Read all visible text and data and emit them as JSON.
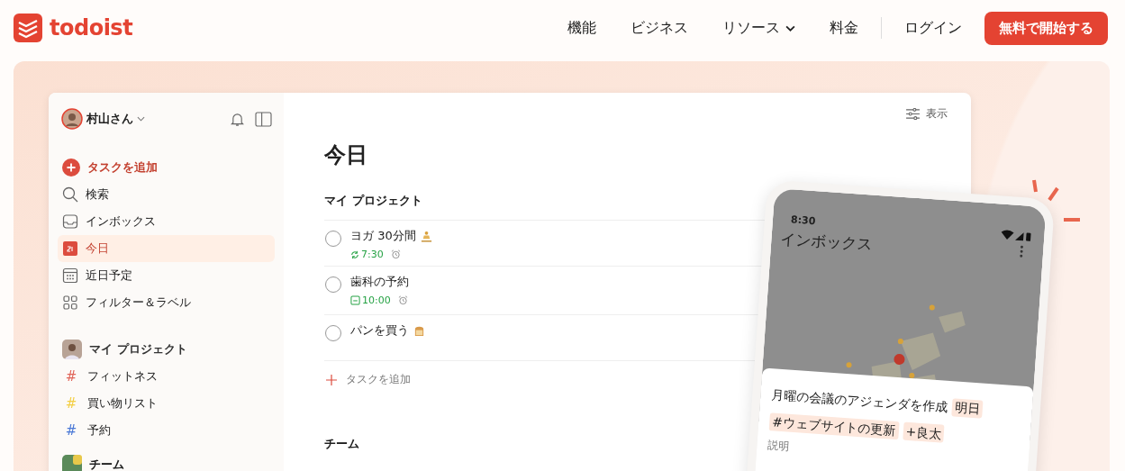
{
  "header": {
    "logo": "todoist",
    "nav": [
      {
        "label": "機能",
        "dropdown": false
      },
      {
        "label": "ビジネス",
        "dropdown": false
      },
      {
        "label": "リソース",
        "dropdown": true
      },
      {
        "label": "料金",
        "dropdown": false
      }
    ],
    "login": "ログイン",
    "cta": "無料で開始する"
  },
  "sidebar": {
    "user": "村山さん",
    "items": [
      {
        "label": "タスクを追加",
        "kind": "add",
        "selected": false
      },
      {
        "label": "検索",
        "kind": "search",
        "selected": false
      },
      {
        "label": "インボックス",
        "kind": "inbox",
        "selected": false
      },
      {
        "label": "今日",
        "kind": "today",
        "selected": true
      },
      {
        "label": "近日予定",
        "kind": "upcoming",
        "selected": false
      },
      {
        "label": "フィルター＆ラベル",
        "kind": "filters",
        "selected": false
      }
    ],
    "projects_header": "マイ プロジェクト",
    "projects": [
      {
        "marker": "#",
        "label": "フィットネス",
        "color": "#e0655a"
      },
      {
        "marker": "#",
        "label": "買い物リスト",
        "color": "#f3cf45"
      },
      {
        "marker": "#",
        "label": "予約",
        "color": "#4a78d6"
      }
    ],
    "team": "チーム"
  },
  "main": {
    "view_button": "表示",
    "title": "今日",
    "section": "マイ プロジェクト",
    "tasks": [
      {
        "title": "ヨガ 30分間",
        "emoji": {
          "kind": "meditation"
        },
        "due": {
          "kind": "recurring",
          "time": "7:30"
        },
        "reminder": true,
        "checked": false
      },
      {
        "title": "歯科の予約",
        "due": {
          "kind": "date",
          "time": "10:00"
        },
        "reminder": true,
        "checked": false
      },
      {
        "title": "パンを買う",
        "emoji": {
          "kind": "bread"
        },
        "checked": false,
        "reminder": false
      }
    ],
    "add_task": "タスクを追加",
    "section_2": "チーム"
  },
  "phone": {
    "time": "8:30",
    "title": "インボックス",
    "card": {
      "title": "月曜の会議のアジェンダを作成",
      "tags": [
        "明日",
        "#ウェブサイトの更新",
        "+良太"
      ],
      "description": "説明"
    }
  }
}
